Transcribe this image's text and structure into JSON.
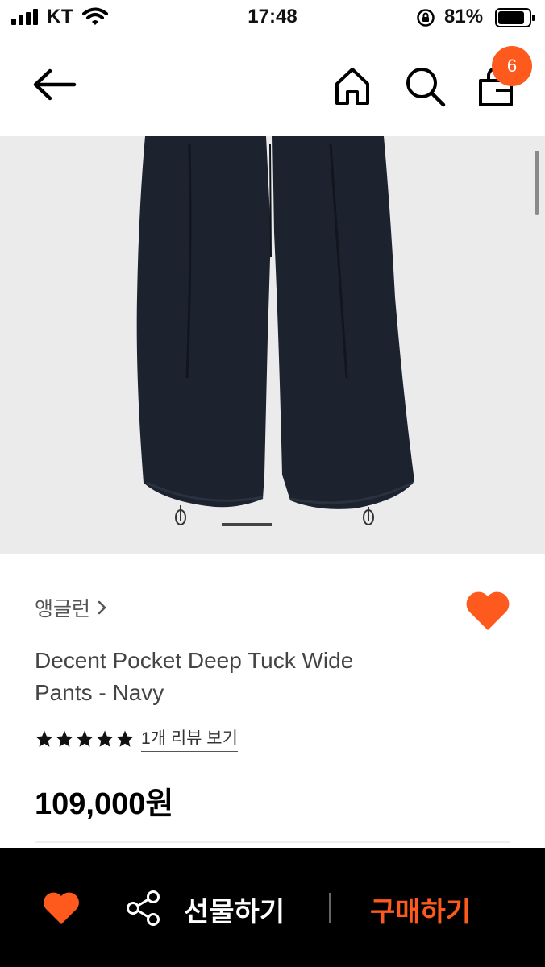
{
  "status_bar": {
    "carrier": "KT",
    "time": "17:48",
    "battery_percent": "81%",
    "icons": [
      "signal-icon",
      "wifi-icon",
      "orientation-lock-icon",
      "battery-icon"
    ]
  },
  "nav": {
    "icons": [
      "back-arrow-icon",
      "home-icon",
      "search-icon",
      "shopping-bag-icon"
    ],
    "cart_count": "6"
  },
  "product": {
    "brand": "앵글런",
    "title": "Decent Pocket Deep Tuck Wide Pants - Navy",
    "rating_stars": 5,
    "review_link": "1개 리뷰 보기",
    "price": "109,000원",
    "image_page": 1
  },
  "bottom_bar": {
    "gift_label": "선물하기",
    "buy_label": "구매하기"
  },
  "colors": {
    "accent": "#ff5a1e",
    "bottom_bar_bg": "#000000",
    "image_bg": "#ebebeb",
    "pants": "#1c232f"
  }
}
